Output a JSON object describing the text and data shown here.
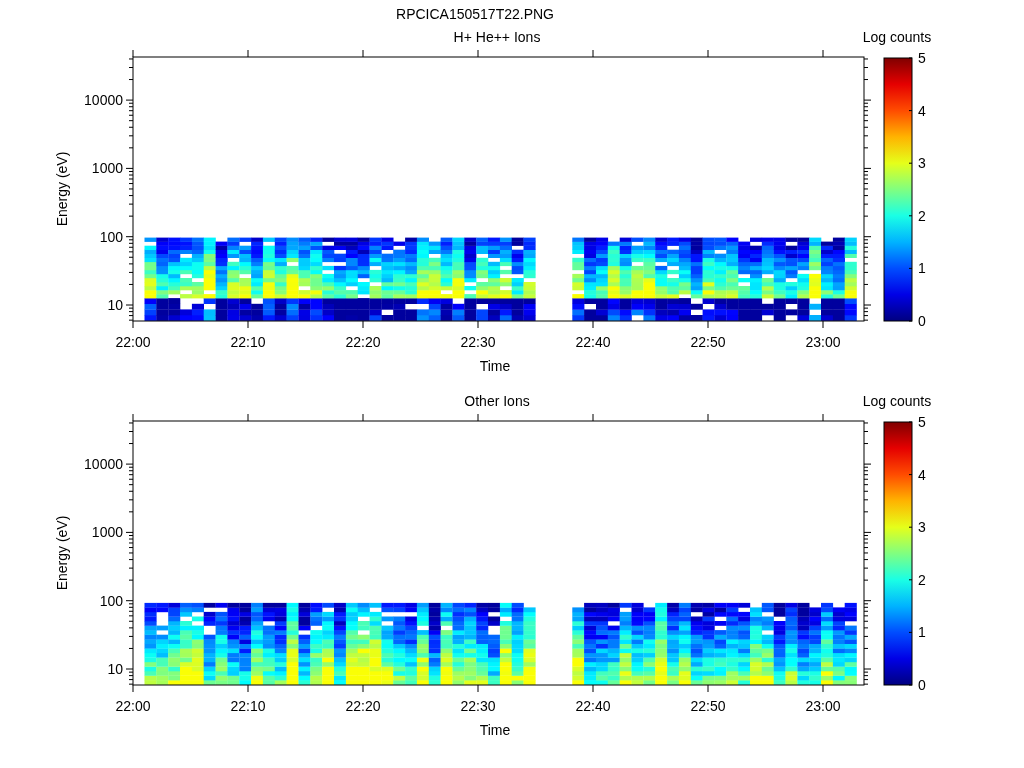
{
  "title": "RPCICA150517T22.PNG",
  "panels": [
    {
      "title": "H+ He++ Ions",
      "ylabel": "Energy (eV)",
      "yticks": [
        "10000",
        "1000",
        "100",
        "10"
      ],
      "xlabel": "Time",
      "xticks": [
        "22:00",
        "22:10",
        "22:20",
        "22:30",
        "22:40",
        "22:50",
        "23:00"
      ],
      "colorbar": {
        "label": "Log counts",
        "ticks": [
          "5",
          "4",
          "3",
          "2",
          "1",
          "0"
        ]
      }
    },
    {
      "title": "Other Ions",
      "ylabel": "Energy (eV)",
      "yticks": [
        "10000",
        "1000",
        "100",
        "10"
      ],
      "xlabel": "Time",
      "xticks": [
        "22:00",
        "22:10",
        "22:20",
        "22:30",
        "22:40",
        "22:50",
        "23:00"
      ],
      "colorbar": {
        "label": "Log counts",
        "ticks": [
          "5",
          "4",
          "3",
          "2",
          "1",
          "0"
        ]
      }
    }
  ]
}
